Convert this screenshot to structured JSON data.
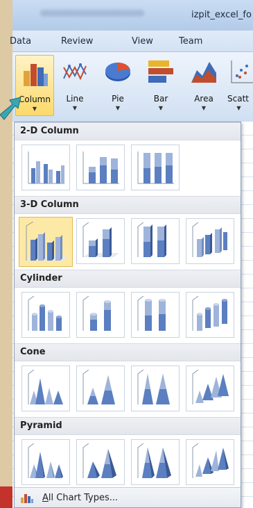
{
  "window": {
    "title": "izpit_excel_fo"
  },
  "tabs": [
    "Data",
    "Review",
    "View",
    "Team"
  ],
  "ribbon": {
    "buttons": [
      {
        "label": "Column",
        "icon": "column-chart-icon",
        "active": true
      },
      {
        "label": "Line",
        "icon": "line-chart-icon"
      },
      {
        "label": "Pie",
        "icon": "pie-chart-icon"
      },
      {
        "label": "Bar",
        "icon": "bar-chart-icon"
      },
      {
        "label": "Area",
        "icon": "area-chart-icon"
      },
      {
        "label": "Scatt",
        "icon": "scatter-chart-icon"
      }
    ]
  },
  "gallery": {
    "sections": [
      {
        "title": "2-D Column",
        "items": [
          "clustered-column",
          "stacked-column",
          "100-stacked-column"
        ]
      },
      {
        "title": "3-D Column",
        "items": [
          "3d-clustered-column",
          "3d-stacked-column",
          "3d-100-stacked-column",
          "3d-column"
        ],
        "selected": 0
      },
      {
        "title": "Cylinder",
        "items": [
          "clustered-cylinder",
          "stacked-cylinder",
          "100-stacked-cylinder",
          "3d-cylinder"
        ]
      },
      {
        "title": "Cone",
        "items": [
          "clustered-cone",
          "stacked-cone",
          "100-stacked-cone",
          "3d-cone"
        ]
      },
      {
        "title": "Pyramid",
        "items": [
          "clustered-pyramid",
          "stacked-pyramid",
          "100-stacked-pyramid",
          "3d-pyramid"
        ]
      }
    ],
    "footer": {
      "label_first": "A",
      "label_rest": "ll Chart Types..."
    }
  },
  "colors": {
    "accent": "#fcd96a",
    "chart_blue": "#5b7fc0",
    "ribbon_bg": "#dce8f6"
  }
}
